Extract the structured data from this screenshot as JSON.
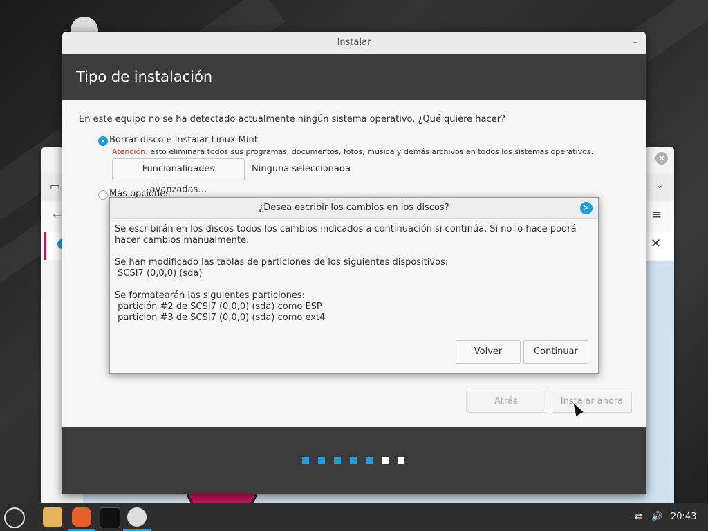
{
  "installer": {
    "window_title": "Instalar",
    "minimize_glyph": "–",
    "header_title": "Tipo de instalación",
    "question": "En este equipo no se ha detectado actualmente ningún sistema operativo. ¿Qué quiere hacer?",
    "option_erase": "Borrar disco e instalar Linux Mint",
    "warning_label": "Atención:",
    "warning_text": " esto eliminará todos sus programas, documentos, fotos, música y demás archivos en todos los sistemas operativos.",
    "advanced_button": "Funcionalidades avanzadas…",
    "advanced_status": "Ninguna seleccionada",
    "option_more": "Más opciones",
    "back_button": "Atrás",
    "install_button": "Instalar ahora",
    "progress": {
      "total_steps": 7,
      "completed_steps": 5
    },
    "accent_color": "#1f9ede"
  },
  "dialog": {
    "title": "¿Desea escribir los cambios en los discos?",
    "close_glyph": "✕",
    "paragraph1": "Se escribirán en los discos todos los cambios indicados a continuación si continúa. Si no lo hace podrá hacer cambios manualmente.",
    "paragraph2_title": "Se han modificado las tablas de particiones de los siguientes dispositivos:",
    "devices": [
      " SCSI7 (0,0,0) (sda)"
    ],
    "paragraph3_title": "Se formatearán las siguientes particiones:",
    "partitions": [
      " partición #2 de SCSI7 (0,0,0) (sda) como ESP",
      " partición #3 de SCSI7 (0,0,0) (sda) como ext4"
    ],
    "back_button": "Volver",
    "continue_button": "Continuar"
  },
  "browser": {
    "close_glyph": "✕"
  },
  "taskbar": {
    "clock": "20:43",
    "icons": [
      "mint-menu-icon",
      "files-icon",
      "firefox-icon",
      "terminal-icon",
      "disc-installer-icon"
    ]
  }
}
